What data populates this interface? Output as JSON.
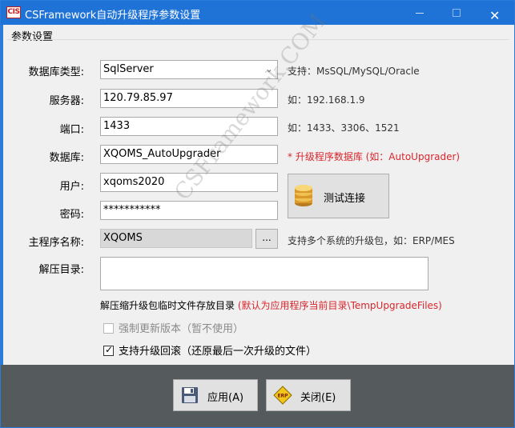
{
  "window": {
    "icon_text": "CIS",
    "title": "CSFramework自动升级程序参数设置"
  },
  "group": {
    "label": "参数设置"
  },
  "form": {
    "db_type": {
      "label": "数据库类型:",
      "value": "SqlServer",
      "hint": "支持：MsSQL/MySQL/Oracle"
    },
    "server": {
      "label": "服务器:",
      "value": "120.79.85.97",
      "hint": "如：192.168.1.9"
    },
    "port": {
      "label": "端口:",
      "value": "1433",
      "hint": "如：1433、3306、1521"
    },
    "database": {
      "label": "数据库:",
      "value": "XQOMS_AutoUpgrader",
      "hint": "* 升级程序数据库 (如：AutoUpgrader)"
    },
    "user": {
      "label": "用户:",
      "value": "xqoms2020"
    },
    "password": {
      "label": "密码:",
      "value": "***********"
    },
    "main_program": {
      "label": "主程序名称:",
      "value": "XQOMS",
      "browse_label": "...",
      "hint": "支持多个系统的升级包，如：ERP/MES"
    },
    "extract_dir": {
      "label": "解压目录:",
      "value": ""
    },
    "extract_note": "解压缩升级包临时文件存放目录",
    "extract_note_red": "(默认为应用程序当前目录\\TempUpgradeFiles)"
  },
  "test_button": {
    "label": "测试连接"
  },
  "options": {
    "force_update": {
      "label": "强制更新版本（暂不使用）",
      "checked": false,
      "enabled": false
    },
    "rollback": {
      "label": "支持升级回滚（还原最后一次升级的文件）",
      "checked": true,
      "enabled": true
    }
  },
  "footer": {
    "apply_label": "应用(A)",
    "close_label": "关闭(E)",
    "close_icon_text": "ERP"
  },
  "watermark": "CSFramework.COM",
  "colors": {
    "titlebar": "#1f72d6",
    "footer": "#555a5d",
    "hint_red": "#d8262c"
  }
}
